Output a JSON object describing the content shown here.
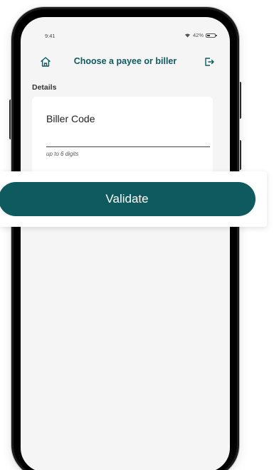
{
  "status_bar": {
    "time": "9:41",
    "battery_percent": "42%",
    "battery_level": 0.42
  },
  "header": {
    "title": "Choose a payee or biller",
    "home_icon": "home-icon",
    "logout_icon": "logout-icon"
  },
  "details": {
    "section_label": "Details",
    "field_label": "Biller Code",
    "field_value": "",
    "hint": "up to 6 digits"
  },
  "actions": {
    "validate_label": "Validate"
  },
  "colors": {
    "accent": "#0f5a5e",
    "screen_bg": "#f5f5f5",
    "card_bg": "#ffffff",
    "frame": "#1b1b1b"
  }
}
